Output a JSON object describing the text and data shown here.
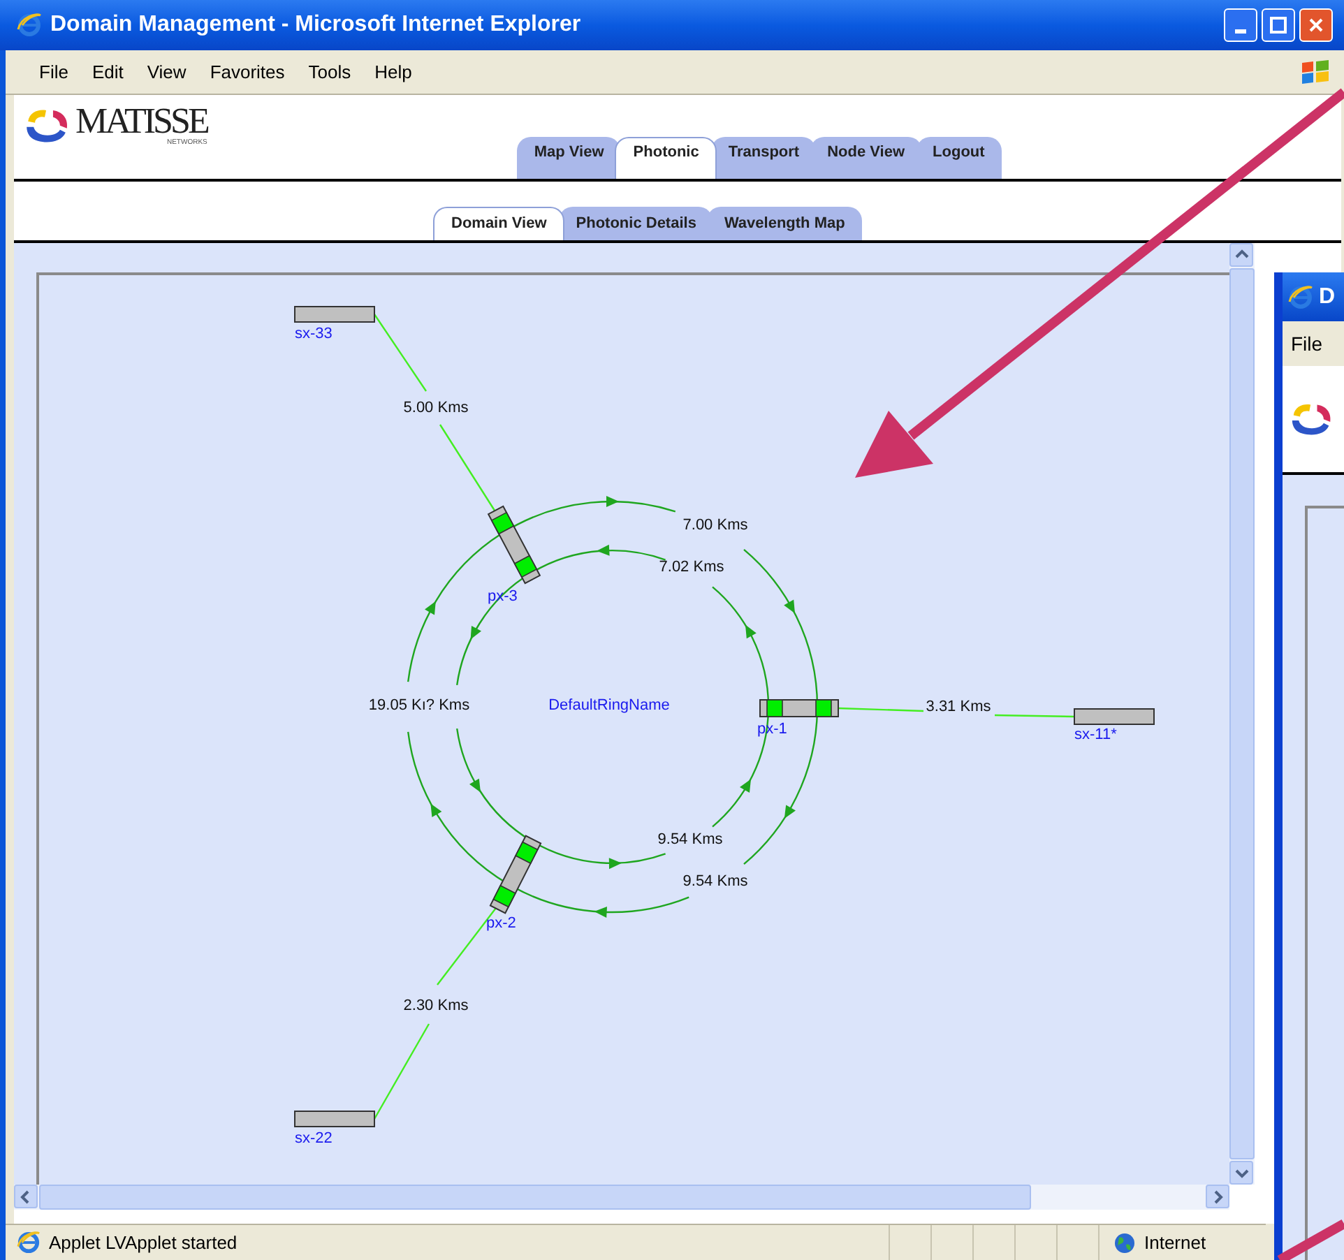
{
  "window": {
    "title": "Domain Management - Microsoft Internet Explorer"
  },
  "menu": [
    "File",
    "Edit",
    "View",
    "Favorites",
    "Tools",
    "Help"
  ],
  "logo": {
    "text": "MATISSE",
    "subtext": "NETWORKS"
  },
  "tabs": [
    {
      "label": "Map View",
      "selected": false
    },
    {
      "label": "Photonic",
      "selected": true
    },
    {
      "label": "Transport",
      "selected": false
    },
    {
      "label": "Node View",
      "selected": false
    },
    {
      "label": "Logout",
      "selected": false
    }
  ],
  "subtabs": [
    {
      "label": "Domain View",
      "selected": true
    },
    {
      "label": "Photonic Details",
      "selected": false
    },
    {
      "label": "Wavelength Map",
      "selected": false
    }
  ],
  "diagram": {
    "ring": {
      "name": "DefaultRingName",
      "span_labels": [
        "7.00 Kms",
        "7.02 Kms",
        "19.05 Kı? Kms",
        "9.54 Kms",
        "9.54 Kms"
      ]
    },
    "nodes": [
      {
        "name": "sx-33",
        "kind": "shelf"
      },
      {
        "name": "px-3",
        "kind": "switch"
      },
      {
        "name": "px-1",
        "kind": "switch"
      },
      {
        "name": "sx-11*",
        "kind": "shelf"
      },
      {
        "name": "px-2",
        "kind": "switch"
      },
      {
        "name": "sx-22",
        "kind": "shelf"
      }
    ],
    "links": [
      {
        "label": "5.00 Kms"
      },
      {
        "label": "3.31 Kms"
      },
      {
        "label": "2.30 Kms"
      }
    ]
  },
  "status_bar": {
    "text": "Applet LVApplet started",
    "zone": "Internet"
  },
  "background_window": {
    "title": "D",
    "menu": [
      "File"
    ]
  }
}
